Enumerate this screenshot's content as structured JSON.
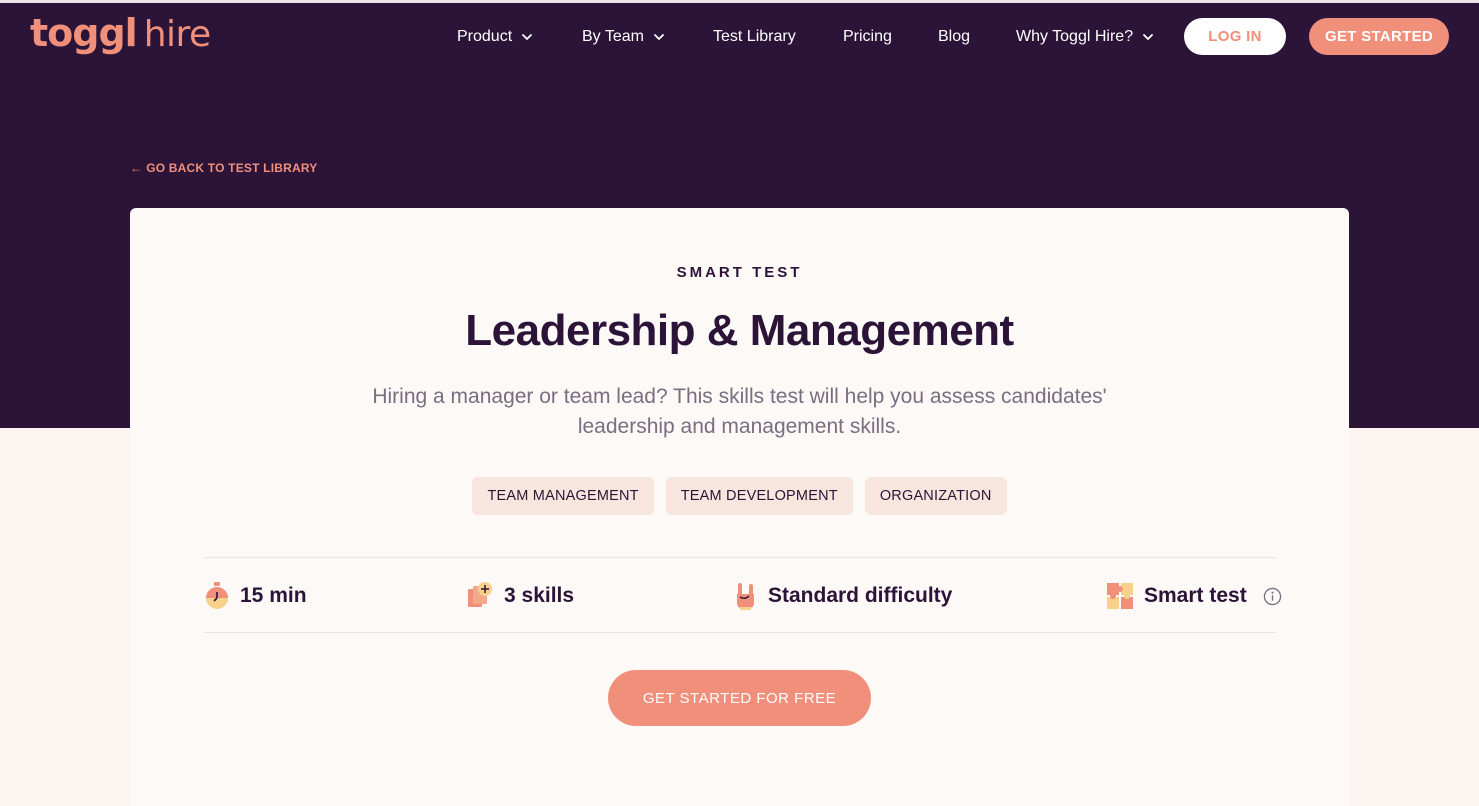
{
  "brand": {
    "name_bold": "toggl",
    "name_light": "hire",
    "accent": "#f0907a",
    "dark": "#2c1338"
  },
  "nav": {
    "items": [
      {
        "label": "Product",
        "dropdown": true
      },
      {
        "label": "By Team",
        "dropdown": true
      },
      {
        "label": "Test Library",
        "dropdown": false
      },
      {
        "label": "Pricing",
        "dropdown": false
      },
      {
        "label": "Blog",
        "dropdown": false
      },
      {
        "label": "Why Toggl Hire?",
        "dropdown": true
      }
    ],
    "login_label": "LOG IN",
    "get_started_label": "GET STARTED"
  },
  "back_link": {
    "arrow": "←",
    "label": "GO BACK TO TEST LIBRARY"
  },
  "card": {
    "eyebrow": "SMART TEST",
    "title": "Leadership & Management",
    "subtitle": "Hiring a manager or team lead? This skills test will help you assess candidates' leadership and management skills.",
    "tags": [
      "TEAM MANAGEMENT",
      "TEAM DEVELOPMENT",
      "ORGANIZATION"
    ],
    "stats": [
      {
        "icon": "stopwatch-icon",
        "label": "15 min"
      },
      {
        "icon": "skills-cards-icon",
        "label": "3 skills"
      },
      {
        "icon": "rock-hand-icon",
        "label": "Standard difficulty"
      },
      {
        "icon": "puzzle-icon",
        "label": "Smart test"
      }
    ],
    "cta_label": "GET STARTED FOR FREE"
  }
}
